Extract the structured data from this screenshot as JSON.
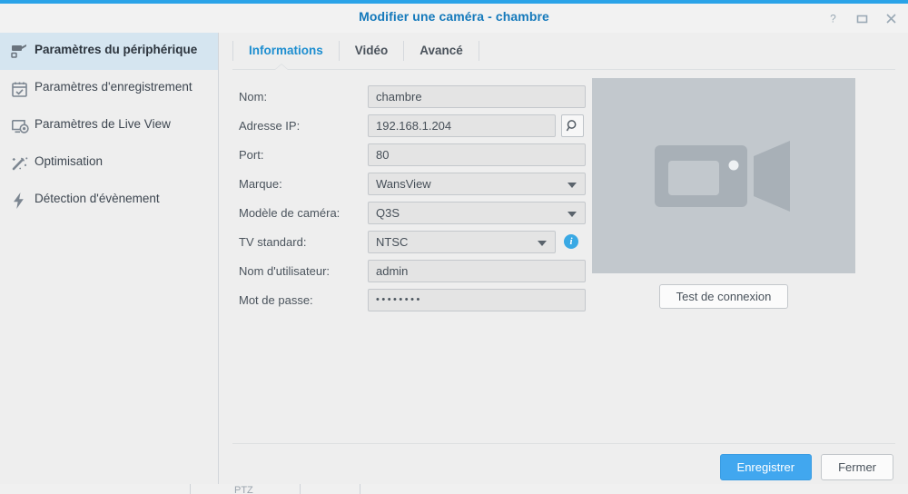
{
  "window": {
    "title": "Modifier une caméra - chambre",
    "controls": [
      {
        "name": "help-icon",
        "glyph": "?"
      },
      {
        "name": "maximize-icon",
        "glyph": "□"
      },
      {
        "name": "close-icon",
        "glyph": "✕"
      }
    ]
  },
  "sidebar": {
    "items": [
      {
        "label": "Paramètres du périphérique",
        "icon": "camera-icon",
        "active": true
      },
      {
        "label": "Paramètres d'enregistrement",
        "icon": "calendar-check-icon",
        "active": false
      },
      {
        "label": "Paramètres de Live View",
        "icon": "monitor-record-icon",
        "active": false
      },
      {
        "label": "Optimisation",
        "icon": "magic-wand-icon",
        "active": false
      },
      {
        "label": "Détection d'évènement",
        "icon": "lightning-bolt-icon",
        "active": false
      }
    ]
  },
  "tabs": [
    {
      "label": "Informations",
      "active": true
    },
    {
      "label": "Vidéo",
      "active": false
    },
    {
      "label": "Avancé",
      "active": false
    }
  ],
  "form": {
    "name": {
      "label": "Nom:",
      "value": "chambre"
    },
    "ip_address": {
      "label": "Adresse IP:",
      "value": "192.168.1.204",
      "search_button": "search-icon"
    },
    "port": {
      "label": "Port:",
      "value": "80"
    },
    "brand": {
      "label": "Marque:",
      "value": "WansView"
    },
    "camera_model": {
      "label": "Modèle de caméra:",
      "value": "Q3S"
    },
    "tv_standard": {
      "label": "TV standard:",
      "value": "NTSC",
      "info": "i"
    },
    "username": {
      "label": "Nom d'utilisateur:",
      "value": "admin"
    },
    "password": {
      "label": "Mot de passe:",
      "value": "••••••••"
    }
  },
  "preview": {
    "icon": "video-camera-placeholder-icon",
    "test_button": "Test de connexion"
  },
  "footer": {
    "save_label": "Enregistrer",
    "close_label": "Fermer"
  },
  "colors": {
    "accent_blue": "#2aa3e8",
    "title_blue": "#1479bb",
    "primary_button": "#41a7ef",
    "sidebar_active": "#d5e5f0",
    "preview_bg": "#c2c8cd",
    "info_icon": "#3aa9e4"
  },
  "background_strip": {
    "ghost_label": "PTZ"
  }
}
